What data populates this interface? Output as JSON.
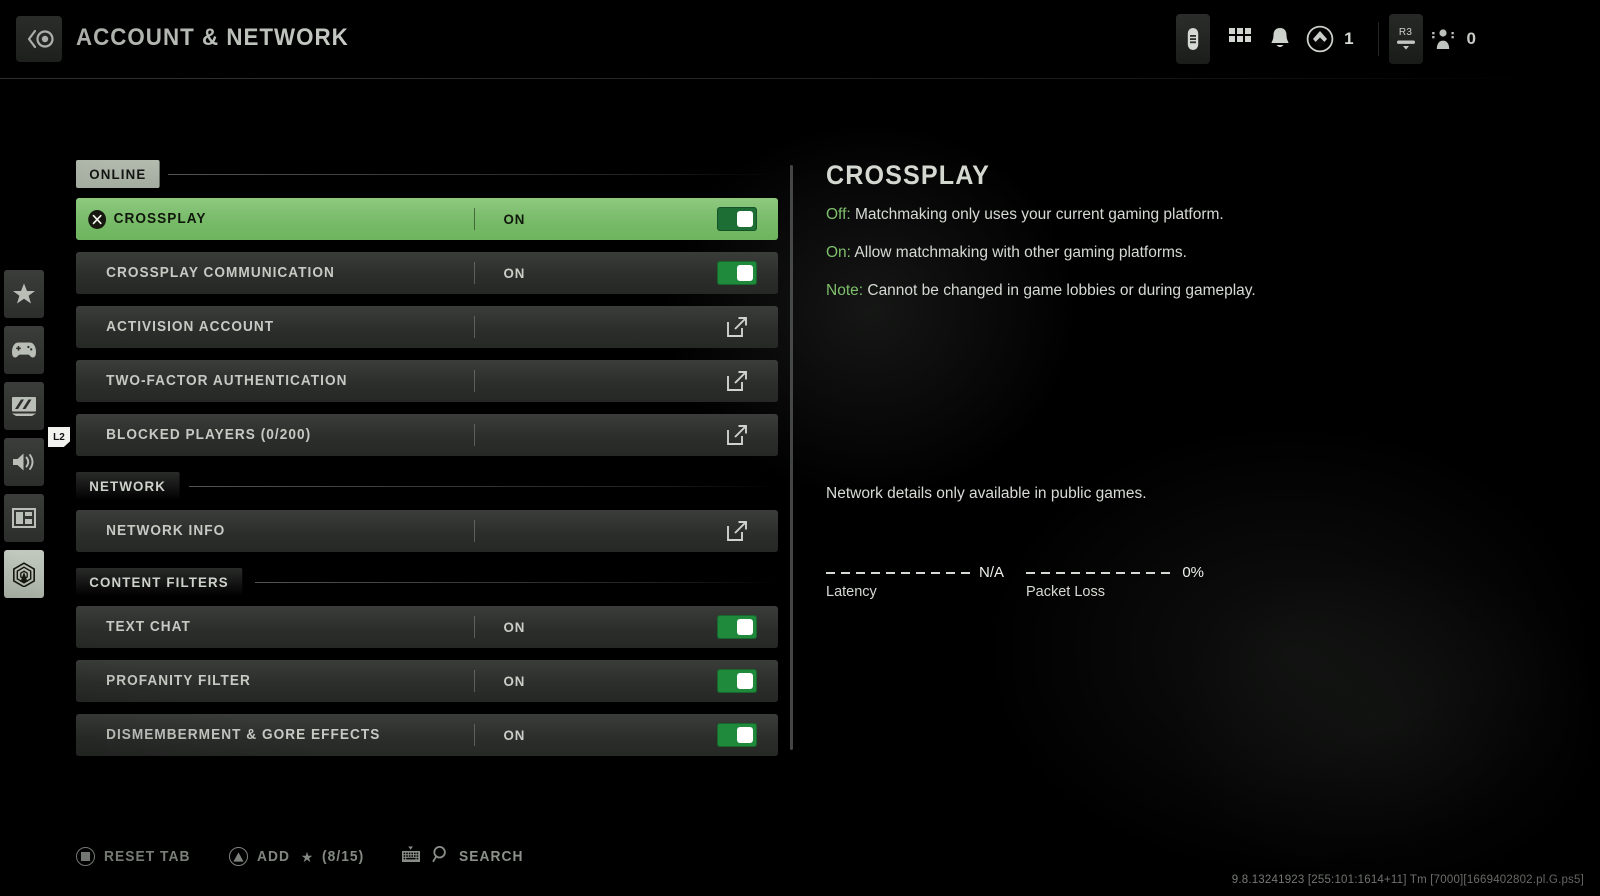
{
  "header": {
    "title": "ACCOUNT & NETWORK",
    "back_icon": "back-circle-icon",
    "icons": [
      {
        "name": "battery-icon",
        "label": ""
      },
      {
        "name": "grid-apps-icon",
        "label": ""
      },
      {
        "name": "bell-notification-icon",
        "label": ""
      },
      {
        "name": "diamond-rank-icon",
        "label": "1"
      },
      {
        "name": "r3-stick-button-icon",
        "label": "R3"
      },
      {
        "name": "players-online-icon",
        "label": "0"
      }
    ]
  },
  "rail": {
    "hint_tag": "L2",
    "items": [
      {
        "name": "sidebar-item-favorites",
        "icon": "star-icon",
        "active": false
      },
      {
        "name": "sidebar-item-controller",
        "icon": "gamepad-icon",
        "active": false
      },
      {
        "name": "sidebar-item-graphics",
        "icon": "monitor-icon",
        "active": false
      },
      {
        "name": "sidebar-item-audio",
        "icon": "speaker-icon",
        "active": false
      },
      {
        "name": "sidebar-item-interface",
        "icon": "layout-icon",
        "active": false
      },
      {
        "name": "sidebar-item-account-network",
        "icon": "network-signal-icon",
        "active": true
      }
    ]
  },
  "settings": {
    "sections": [
      {
        "title": "ONLINE",
        "active": true,
        "rows": [
          {
            "label": "CROSSPLAY",
            "value": "ON",
            "control": "toggle",
            "state": "on",
            "selected": true
          },
          {
            "label": "CROSSPLAY COMMUNICATION",
            "value": "ON",
            "control": "toggle",
            "state": "on",
            "selected": false
          },
          {
            "label": "ACTIVISION ACCOUNT",
            "value": "",
            "control": "link",
            "state": "",
            "selected": false
          },
          {
            "label": "TWO-FACTOR AUTHENTICATION",
            "value": "",
            "control": "link",
            "state": "",
            "selected": false
          },
          {
            "label": "BLOCKED PLAYERS (0/200)",
            "value": "",
            "control": "link",
            "state": "",
            "selected": false
          }
        ]
      },
      {
        "title": "NETWORK",
        "active": false,
        "rows": [
          {
            "label": "NETWORK INFO",
            "value": "",
            "control": "link",
            "state": "",
            "selected": false
          }
        ]
      },
      {
        "title": "CONTENT FILTERS",
        "active": false,
        "rows": [
          {
            "label": "TEXT CHAT",
            "value": "ON",
            "control": "toggle",
            "state": "on",
            "selected": false
          },
          {
            "label": "PROFANITY FILTER",
            "value": "ON",
            "control": "toggle",
            "state": "on",
            "selected": false
          },
          {
            "label": "DISMEMBERMENT & GORE EFFECTS",
            "value": "ON",
            "control": "toggle",
            "state": "on",
            "selected": false
          }
        ]
      }
    ]
  },
  "detail": {
    "title": "CROSSPLAY",
    "lines": [
      {
        "key": "Off:",
        "text": " Matchmaking only uses your current gaming platform."
      },
      {
        "key": "On:",
        "text": " Allow matchmaking with other gaming platforms."
      },
      {
        "key": "Note:",
        "text": " Cannot be changed in game lobbies or during gameplay."
      }
    ],
    "network_note": "Network details only available in public games.",
    "meters": [
      {
        "label": "Latency",
        "value": "N/A"
      },
      {
        "label": "Packet Loss",
        "value": "0%"
      }
    ]
  },
  "bottom_bar": {
    "actions": [
      {
        "name": "reset-tab-action",
        "button": "square",
        "label": "RESET TAB"
      },
      {
        "name": "add-favorite-action",
        "button": "triangle",
        "label": "ADD",
        "star": "★",
        "count": "(8/15)"
      },
      {
        "name": "search-action",
        "button": "keyboard",
        "label": "SEARCH"
      }
    ]
  },
  "build_string": "9.8.13241923 [255:101:1614+11] Tm [7000][1669402802.pl.G.ps5]",
  "colors": {
    "accent_green": "#78bb69",
    "toggle_green": "#1f8a3c",
    "panel": "#2c2e2c",
    "text": "#d6dad4"
  }
}
